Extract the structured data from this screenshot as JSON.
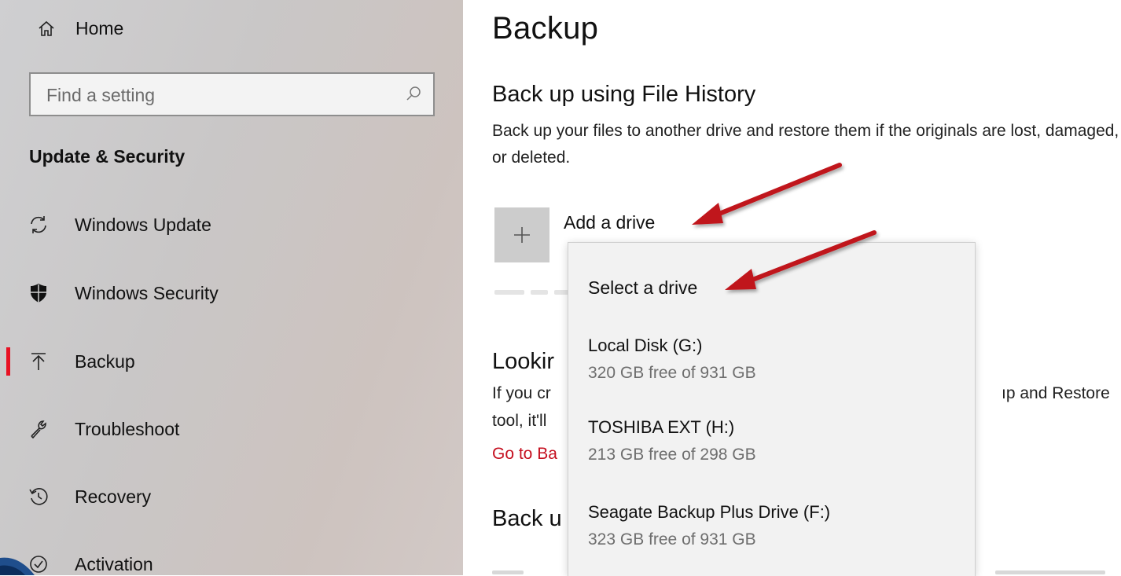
{
  "sidebar": {
    "home_label": "Home",
    "search_placeholder": "Find a setting",
    "section_title": "Update & Security",
    "items": [
      {
        "label": "Windows Update",
        "icon": "sync-icon",
        "active": false
      },
      {
        "label": "Windows Security",
        "icon": "shield-icon",
        "active": false
      },
      {
        "label": "Backup",
        "icon": "backup-arrow-icon",
        "active": true
      },
      {
        "label": "Troubleshoot",
        "icon": "wrench-icon",
        "active": false
      },
      {
        "label": "Recovery",
        "icon": "history-icon",
        "active": false
      },
      {
        "label": "Activation",
        "icon": "check-circle-icon",
        "active": false
      }
    ],
    "active_indicator_color": "#e81123"
  },
  "main": {
    "page_title": "Backup",
    "file_history": {
      "title": "Back up using File History",
      "description": "Back up your files to another drive and restore them if the originals are lost, damaged, or deleted.",
      "add_drive_label": "Add a drive"
    },
    "looking": {
      "title_visible": "Lookir",
      "desc_line1_left": "If you cr",
      "desc_line1_right": "ıp and Restore",
      "desc_line2_left": "tool, it'll",
      "link_visible": "Go to Ba"
    },
    "backup_older_title_visible": "Back u",
    "link_color": "#c50f1f"
  },
  "dropdown": {
    "header": "Select a drive",
    "drives": [
      {
        "name": "Local Disk (G:)",
        "free": "320 GB free of 931 GB"
      },
      {
        "name": "TOSHIBA EXT (H:)",
        "free": "213 GB free of 298 GB"
      },
      {
        "name": "Seagate Backup Plus Drive (F:)",
        "free": "323 GB free of 931 GB"
      }
    ]
  },
  "annotation_arrow_color": "#c0141b"
}
